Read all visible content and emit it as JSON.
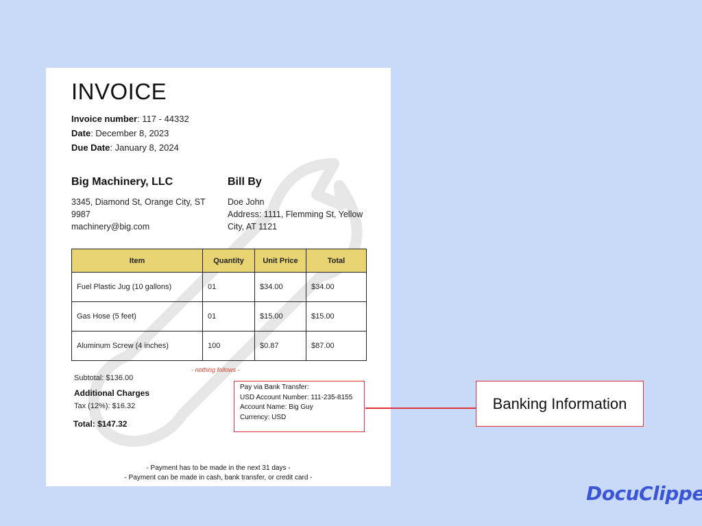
{
  "invoice": {
    "title": "INVOICE",
    "number_label": "Invoice number",
    "number_value": ": 117 - 44332",
    "date_label": "Date",
    "date_value": ": December 8, 2023",
    "due_label": "Due Date",
    "due_value": ": January 8, 2024"
  },
  "company": {
    "name": "Big Machinery, LLC",
    "address_line1": "3345, Diamond St, Orange City, ST",
    "address_line2": "9987",
    "email": "machinery@big.com"
  },
  "bill_by": {
    "heading": "Bill By",
    "name": "Doe John",
    "address_line1": "Address: 1111, Flemming St, Yellow",
    "address_line2": "City, AT 1121"
  },
  "table": {
    "headers": [
      "Item",
      "Quantity",
      "Unit Price",
      "Total"
    ],
    "rows": [
      [
        "Fuel Plastic Jug (10 gallons)",
        "01",
        "$34.00",
        "$34.00"
      ],
      [
        "Gas Hose (5 feet)",
        "01",
        "$15.00",
        "$15.00"
      ],
      [
        "Aluminum Screw (4 inches)",
        "100",
        "$0.87",
        "$87.00"
      ]
    ]
  },
  "nothing_follows": "- nothing follows -",
  "summary": {
    "subtotal": "Subtotal: $136.00",
    "additional_heading": "Additional Charges",
    "tax": "Tax (12%): $16.32",
    "total": "Total: $147.32"
  },
  "bank": {
    "line1": "Pay via Bank Transfer:",
    "line2": "USD Account Number: 111-235-8155",
    "line3": "Account Name: Big Guy",
    "line4": "Currency: USD"
  },
  "footer": {
    "line1": "- Payment has to be made in the next 31 days -",
    "line2": "- Payment can be made in cash, bank transfer, or credit card -"
  },
  "callout_label": "Banking Information",
  "brand": "DocuClipper",
  "colors": {
    "background": "#c9daf8",
    "table_header": "#e8d473",
    "highlight_border": "#e0303f",
    "note_red": "#e0412b",
    "brand_blue": "#3a55d6"
  }
}
